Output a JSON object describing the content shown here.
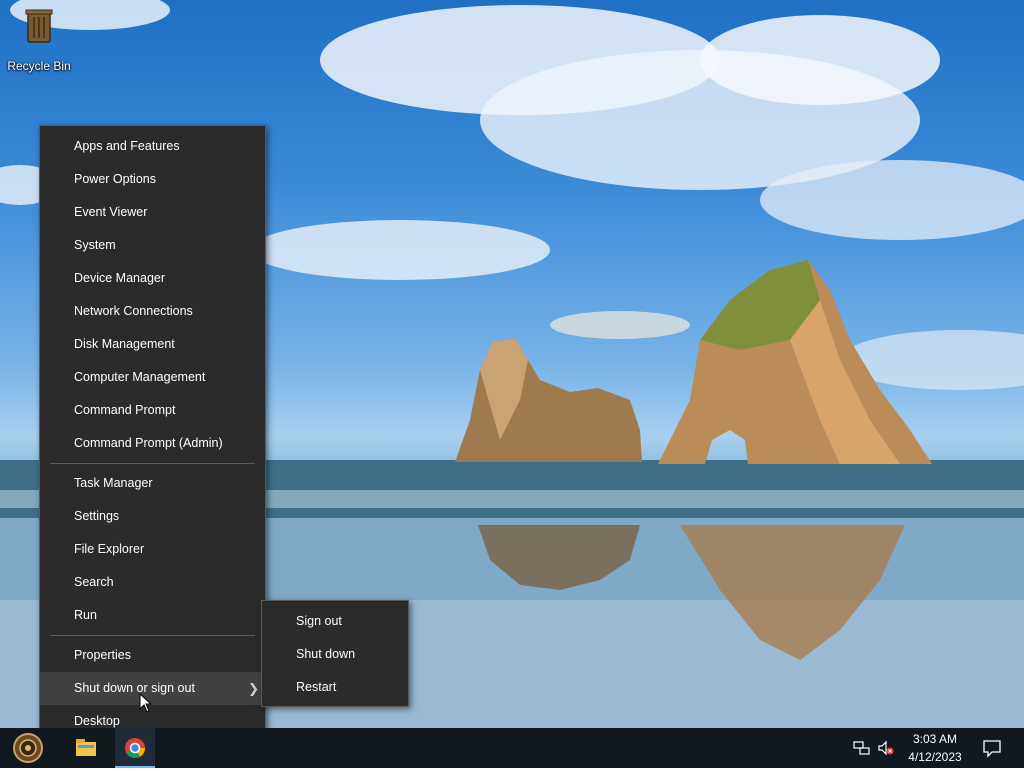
{
  "desktop": {
    "icons": [
      {
        "label": "Recycle Bin",
        "icon": "recycle-bin-icon"
      }
    ]
  },
  "context_menu": {
    "group1": [
      "Apps and Features",
      "Power Options",
      "Event Viewer",
      "System",
      "Device Manager",
      "Network Connections",
      "Disk Management",
      "Computer Management",
      "Command Prompt",
      "Command Prompt (Admin)"
    ],
    "group2": [
      "Task Manager",
      "Settings",
      "File Explorer",
      "Search",
      "Run"
    ],
    "group3": [
      "Properties",
      "Shut down or sign out",
      "Desktop"
    ],
    "active_item": "Shut down or sign out"
  },
  "submenu": {
    "items": [
      "Sign out",
      "Shut down",
      "Restart"
    ]
  },
  "taskbar": {
    "apps": [
      {
        "name": "File Explorer",
        "icon": "folder-icon"
      },
      {
        "name": "Google Chrome",
        "icon": "chrome-icon",
        "active": true
      }
    ],
    "tray": {
      "network_icon": "network-icon",
      "volume_icon": "volume-muted-icon",
      "time": "3:03 AM",
      "date": "4/12/2023",
      "notification_icon": "action-center-icon"
    }
  },
  "colors": {
    "menu_bg": "#2b2b2b",
    "menu_active": "#414141",
    "taskbar_bg": "#101820"
  }
}
